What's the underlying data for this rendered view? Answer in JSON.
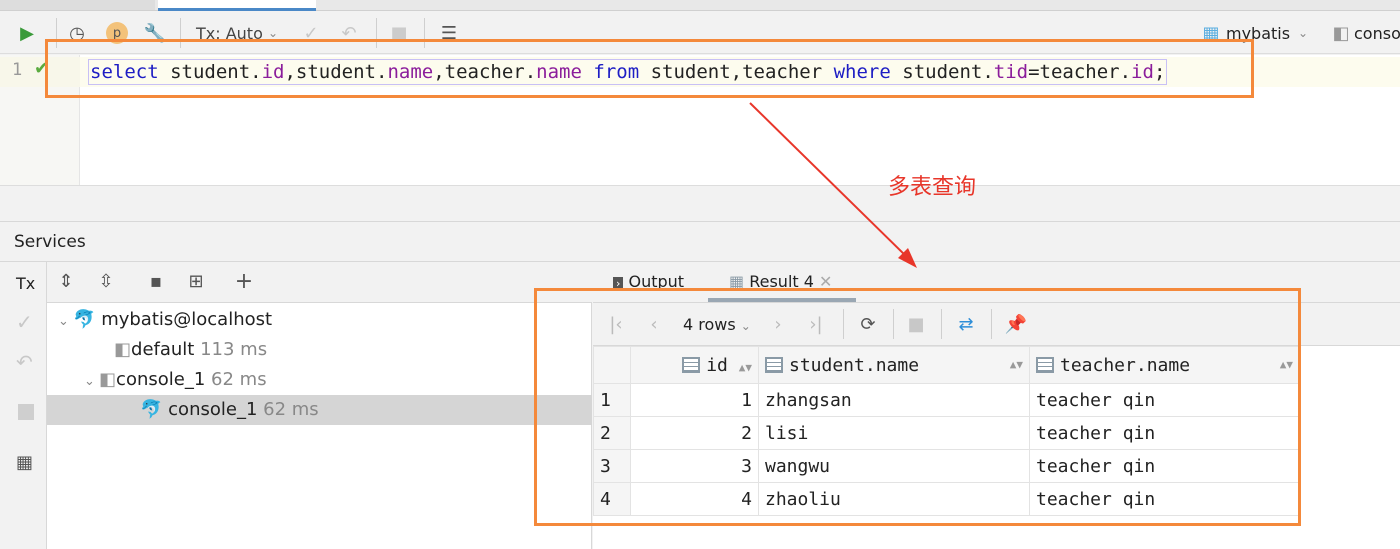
{
  "toolbar": {
    "tx_mode": "Tx: Auto",
    "datasource": "mybatis",
    "console": "conso"
  },
  "editor": {
    "line_number": "1",
    "sql": [
      {
        "t": "select",
        "c": "kw"
      },
      {
        "t": " student.",
        "c": ""
      },
      {
        "t": "id",
        "c": "fld"
      },
      {
        "t": ",student.",
        "c": ""
      },
      {
        "t": "name",
        "c": "fld"
      },
      {
        "t": ",teacher.",
        "c": ""
      },
      {
        "t": "name",
        "c": "fld"
      },
      {
        "t": " ",
        "c": ""
      },
      {
        "t": "from",
        "c": "kw"
      },
      {
        "t": " student,teacher ",
        "c": ""
      },
      {
        "t": "where",
        "c": "kw"
      },
      {
        "t": " student.",
        "c": ""
      },
      {
        "t": "tid",
        "c": "fld"
      },
      {
        "t": "=teacher.",
        "c": ""
      },
      {
        "t": "id",
        "c": "fld"
      },
      {
        "t": ";",
        "c": ""
      }
    ]
  },
  "annotation": "多表查询",
  "services": {
    "title": "Services",
    "tx_label": "Tx",
    "tree": [
      {
        "label": "mybatis@localhost",
        "time": ""
      },
      {
        "label": "default",
        "time": "113 ms"
      },
      {
        "label": "console_1",
        "time": "62 ms"
      },
      {
        "label": "console_1",
        "time": "62 ms"
      }
    ]
  },
  "results": {
    "tabs": [
      "Output",
      "Result 4"
    ],
    "rows_label": "4 rows",
    "columns": [
      "id",
      "student.name",
      "teacher.name"
    ],
    "rows": [
      [
        "1",
        "1",
        "zhangsan",
        "teacher qin"
      ],
      [
        "2",
        "2",
        "lisi",
        "teacher qin"
      ],
      [
        "3",
        "3",
        "wangwu",
        "teacher qin"
      ],
      [
        "4",
        "4",
        "zhaoliu",
        "teacher qin"
      ]
    ]
  },
  "colors": {
    "accent": "#f4893b",
    "annotation": "#e8362a"
  }
}
